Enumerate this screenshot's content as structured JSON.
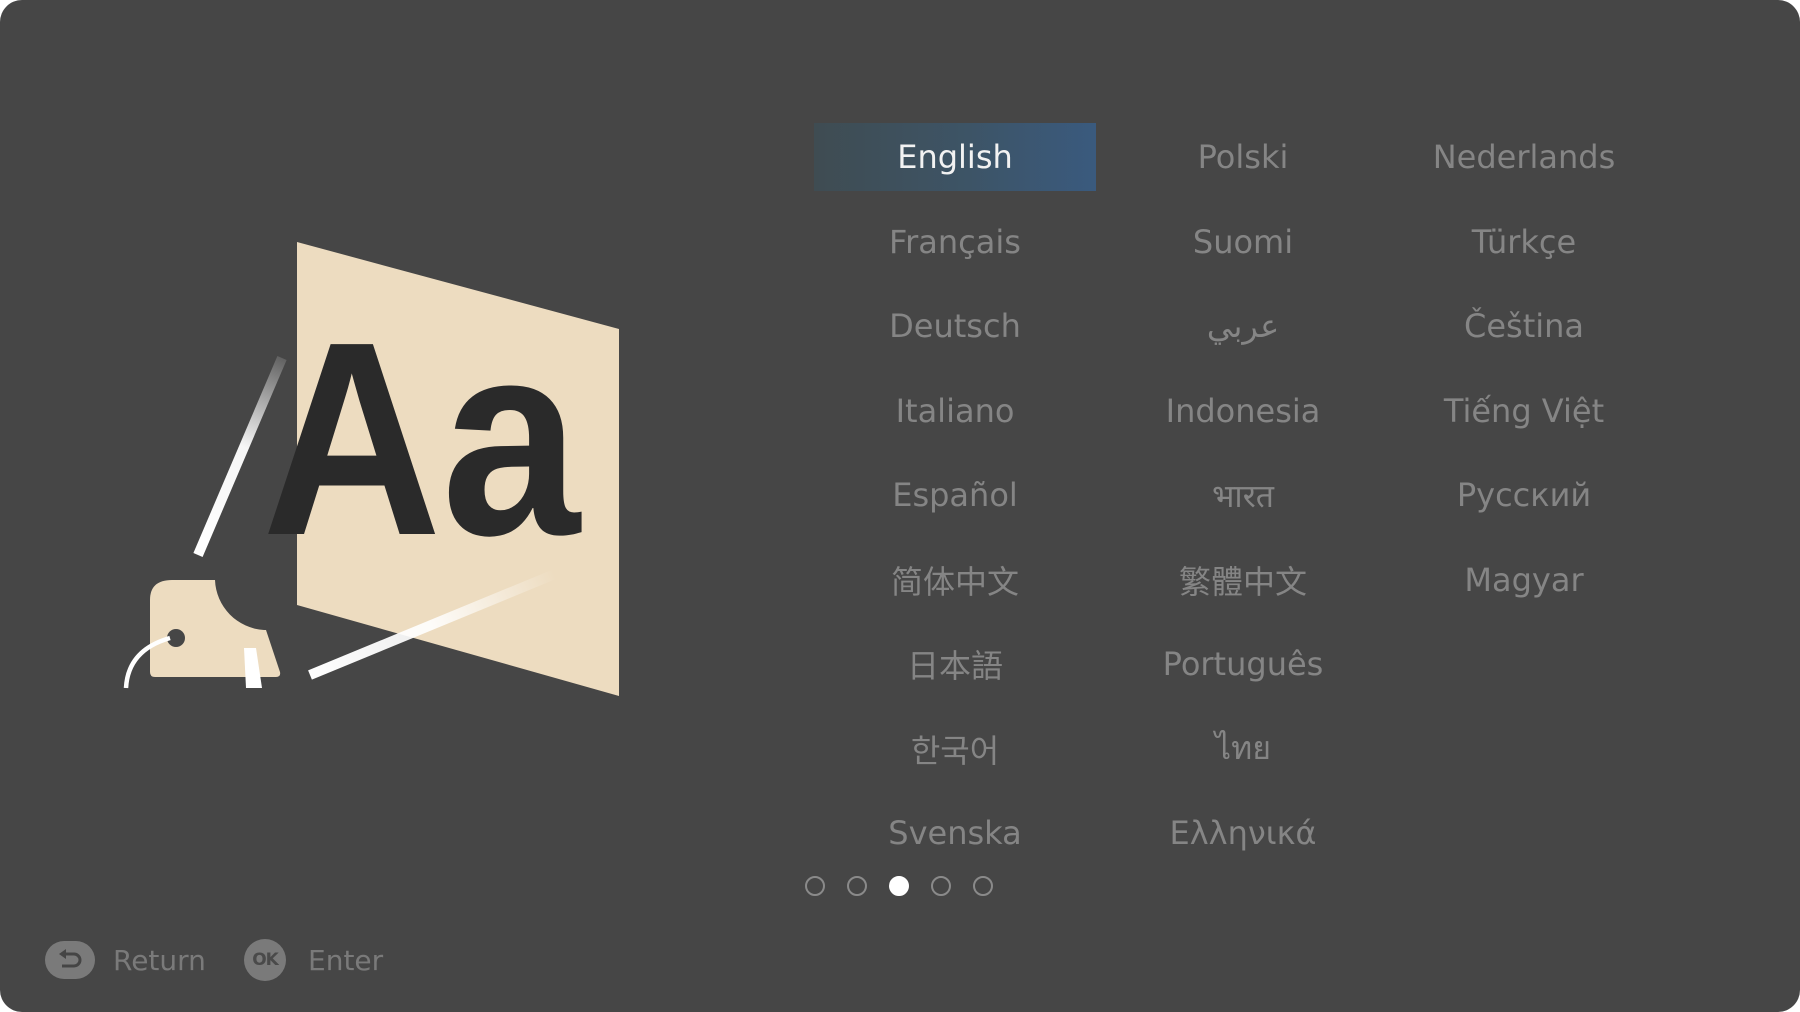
{
  "screen": "language-selection",
  "colors": {
    "background": "#464646",
    "text": "#858585",
    "selected_text": "#f2f2f2",
    "selected_gradient": [
      "#3f4c52",
      "#3a5a7e"
    ],
    "illustration_screen": "#eddcc0",
    "illustration_glyph": "#2a2a2a"
  },
  "illustration": {
    "glyph_text": "Aa",
    "icon": "projector-language-icon"
  },
  "languages": {
    "columns": [
      [
        "English",
        "Français",
        "Deutsch",
        "Italiano",
        "Español",
        "简体中文",
        "日本語",
        "한국어",
        "Svenska"
      ],
      [
        "Polski",
        "Suomi",
        "عربي",
        "Indonesia",
        "भारत",
        "繁體中文",
        "Português",
        "ไทย",
        "Ελληνικά"
      ],
      [
        "Nederlands",
        "Türkçe",
        "Čeština",
        "Tiếng Việt",
        "Русский",
        "Magyar"
      ]
    ],
    "selected": "English"
  },
  "pagination": {
    "total_pages": 5,
    "current_page": 3
  },
  "footer": {
    "return_label": "Return",
    "enter_label": "Enter",
    "ok_icon_text": "OK"
  }
}
